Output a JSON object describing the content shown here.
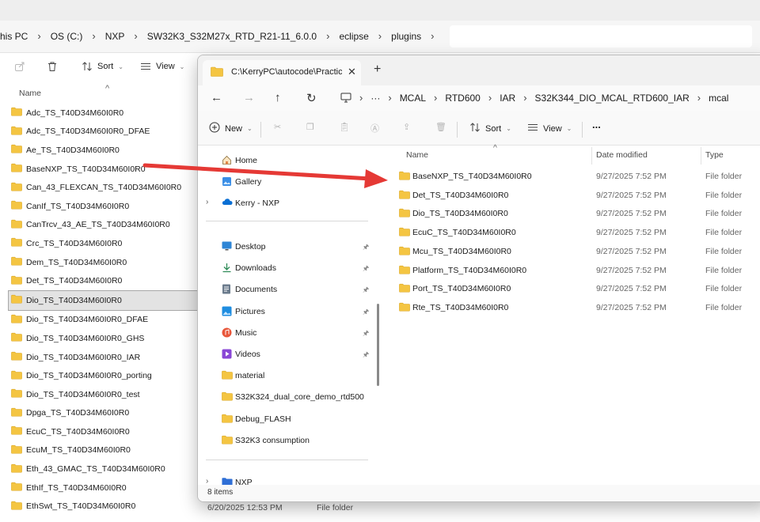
{
  "back_window": {
    "breadcrumbs": [
      "his PC",
      "OS (C:)",
      "NXP",
      "SW32K3_S32M27x_RTD_R21-11_6.0.0",
      "eclipse",
      "plugins"
    ],
    "toolbar": {
      "sort": "Sort",
      "view": "View"
    },
    "column_name": "Name",
    "folders": [
      "Adc_TS_T40D34M60I0R0",
      "Adc_TS_T40D34M60I0R0_DFAE",
      "Ae_TS_T40D34M60I0R0",
      "BaseNXP_TS_T40D34M60I0R0",
      "Can_43_FLEXCAN_TS_T40D34M60I0R0",
      "CanIf_TS_T40D34M60I0R0",
      "CanTrcv_43_AE_TS_T40D34M60I0R0",
      "Crc_TS_T40D34M60I0R0",
      "Dem_TS_T40D34M60I0R0",
      "Det_TS_T40D34M60I0R0",
      "Dio_TS_T40D34M60I0R0",
      "Dio_TS_T40D34M60I0R0_DFAE",
      "Dio_TS_T40D34M60I0R0_GHS",
      "Dio_TS_T40D34M60I0R0_IAR",
      "Dio_TS_T40D34M60I0R0_porting",
      "Dio_TS_T40D34M60I0R0_test",
      "Dpga_TS_T40D34M60I0R0",
      "EcuC_TS_T40D34M60I0R0",
      "EcuM_TS_T40D34M60I0R0",
      "Eth_43_GMAC_TS_T40D34M60I0R0",
      "EthIf_TS_T40D34M60I0R0",
      "EthSwt_TS_T40D34M60I0R0"
    ],
    "selected_folder": "Dio_TS_T40D34M60I0R0",
    "bottom_date": "6/20/2025 12:53 PM",
    "bottom_type": "File folder"
  },
  "front_window": {
    "tab_title": "C:\\KerryPC\\autocode\\Practice\\",
    "breadcrumbs": [
      "MCAL",
      "RTD600",
      "IAR",
      "S32K344_DIO_MCAL_RTD600_IAR",
      "mcal"
    ],
    "toolbar": {
      "new": "New",
      "sort": "Sort",
      "view": "View",
      "more": "..."
    },
    "nav_top": [
      {
        "label": "Home",
        "icon": "home-icon"
      },
      {
        "label": "Gallery",
        "icon": "gallery-icon"
      },
      {
        "label": "Kerry - NXP",
        "icon": "onedrive-cloud-icon"
      }
    ],
    "quick_access": [
      {
        "label": "Desktop",
        "icon": "desktop-icon",
        "pinned": true
      },
      {
        "label": "Downloads",
        "icon": "download-icon",
        "pinned": true
      },
      {
        "label": "Documents",
        "icon": "document-icon",
        "pinned": true
      },
      {
        "label": "Pictures",
        "icon": "pictures-icon",
        "pinned": true
      },
      {
        "label": "Music",
        "icon": "music-icon",
        "pinned": true
      },
      {
        "label": "Videos",
        "icon": "videos-icon",
        "pinned": true
      },
      {
        "label": "material",
        "icon": "folder-icon",
        "pinned": false
      },
      {
        "label": "S32K324_dual_core_demo_rtd500",
        "icon": "folder-icon",
        "pinned": false
      },
      {
        "label": "Debug_FLASH",
        "icon": "folder-icon",
        "pinned": false
      },
      {
        "label": "S32K3 consumption",
        "icon": "folder-icon",
        "pinned": false
      }
    ],
    "nav_bottom": "NXP",
    "columns": {
      "name": "Name",
      "date": "Date modified",
      "type": "Type"
    },
    "files": [
      {
        "name": "BaseNXP_TS_T40D34M60I0R0",
        "date": "9/27/2025 7:52 PM",
        "type": "File folder"
      },
      {
        "name": "Det_TS_T40D34M60I0R0",
        "date": "9/27/2025 7:52 PM",
        "type": "File folder"
      },
      {
        "name": "Dio_TS_T40D34M60I0R0",
        "date": "9/27/2025 7:52 PM",
        "type": "File folder"
      },
      {
        "name": "EcuC_TS_T40D34M60I0R0",
        "date": "9/27/2025 7:52 PM",
        "type": "File folder"
      },
      {
        "name": "Mcu_TS_T40D34M60I0R0",
        "date": "9/27/2025 7:52 PM",
        "type": "File folder"
      },
      {
        "name": "Platform_TS_T40D34M60I0R0",
        "date": "9/27/2025 7:52 PM",
        "type": "File folder"
      },
      {
        "name": "Port_TS_T40D34M60I0R0",
        "date": "9/27/2025 7:52 PM",
        "type": "File folder"
      },
      {
        "name": "Rte_TS_T40D34M60I0R0",
        "date": "9/27/2025 7:52 PM",
        "type": "File folder"
      }
    ],
    "status": "8 items"
  },
  "colors": {
    "folder": "#f4c542",
    "folder_dark": "#d9a520",
    "arrow": "#e53935",
    "accent": "#0067c0"
  }
}
